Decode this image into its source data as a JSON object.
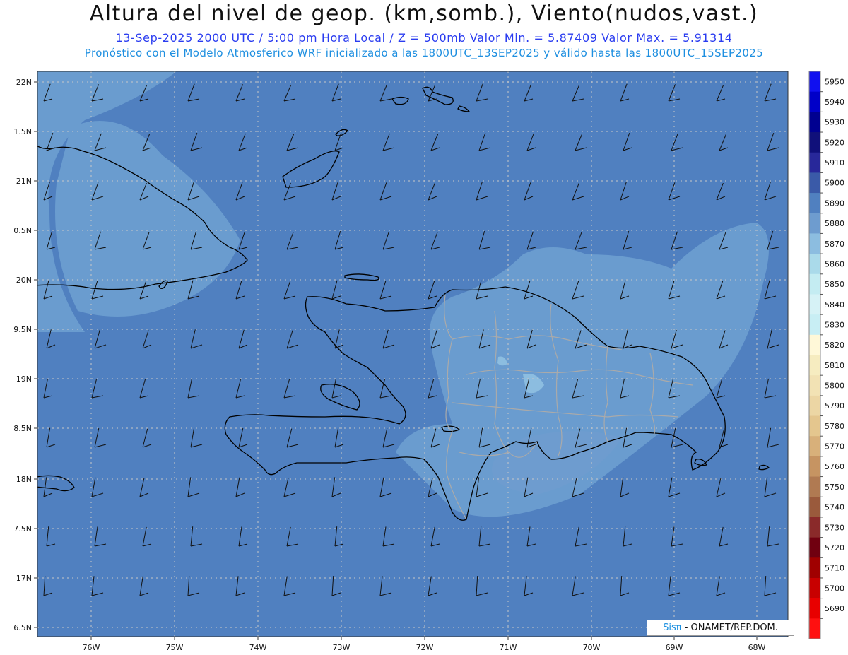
{
  "header": {
    "title": "Altura del nivel de geop. (km,somb.), Viento(nudos,vast.)",
    "subtitle": "13-Sep-2025  2000 UTC / 5:00 pm Hora Local / Z = 500mb     Valor Min. = 5.87409  Valor Max. = 5.91314",
    "description": "Pronóstico con el Modelo Atmosferico WRF inicializado a las 1800UTC_13SEP2025 y válido hasta las  1800UTC_15SEP2025"
  },
  "map": {
    "lon_range": [
      -76.65,
      -67.65
    ],
    "lat_range": [
      16.45,
      22.05
    ],
    "lon_ticks": [
      "76W",
      "75W",
      "74W",
      "73W",
      "72W",
      "71W",
      "70W",
      "69W",
      "68W"
    ],
    "lat_ticks": [
      "22N",
      "1.5N",
      "21N",
      "0.5N",
      "20N",
      "9.5N",
      "19N",
      "8.5N",
      "18N",
      "7.5N",
      "17N",
      "6.5N"
    ],
    "colors": {
      "background": "#5080c0",
      "lighter": "#6a9ccf",
      "lightest": "#7fb0da",
      "darker": "#4470b4",
      "coast": "#000000",
      "borders": "#aaaaaa",
      "grid": "#c8c8c8"
    }
  },
  "colorbar": {
    "levels": [
      "5950",
      "5940",
      "5930",
      "5920",
      "5910",
      "5900",
      "5890",
      "5880",
      "5870",
      "5860",
      "5850",
      "5840",
      "5830",
      "5820",
      "5810",
      "5800",
      "5790",
      "5780",
      "5770",
      "5760",
      "5750",
      "5740",
      "5730",
      "5720",
      "5710",
      "5700",
      "5690"
    ],
    "colors": [
      "#1010f0",
      "#0000c8",
      "#000090",
      "#10107a",
      "#28289a",
      "#3a5aa8",
      "#5080c0",
      "#6e9ccf",
      "#8cbde0",
      "#aadaea",
      "#c4ecf2",
      "#d6f2f6",
      "#c8eef4",
      "#fff8d8",
      "#f6ecc0",
      "#f2e2b4",
      "#ecd6a4",
      "#e4c68e",
      "#d8b07a",
      "#c69462",
      "#b07a52",
      "#9a5a3c",
      "#8a2a2a",
      "#700010",
      "#a00000",
      "#c80000",
      "#e80000",
      "#ff1010"
    ]
  },
  "credit": {
    "sis": "Sisπ",
    "rest": " - ONAMET/REP.DOM."
  }
}
